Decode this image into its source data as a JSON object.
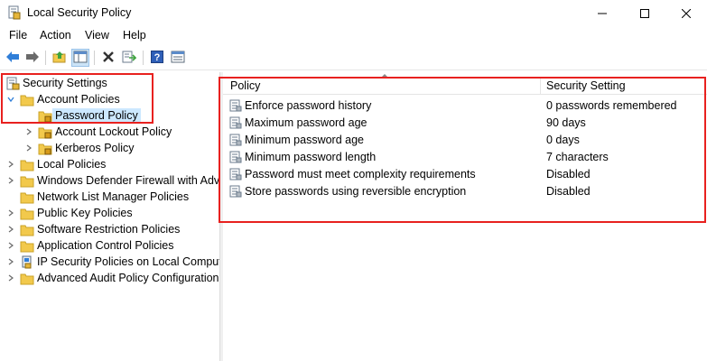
{
  "window": {
    "title": "Local Security Policy",
    "app_icon": "security-policy-icon",
    "controls": [
      "minimize-icon",
      "maximize-icon",
      "close-icon"
    ]
  },
  "menu": {
    "items": [
      "File",
      "Action",
      "View",
      "Help"
    ]
  },
  "toolbar": {
    "buttons": [
      "back-arrow-icon",
      "forward-arrow-icon",
      "up-folder-icon",
      "show-hide-tree-icon",
      "delete-icon",
      "export-list-icon",
      "help-icon",
      "properties-icon"
    ]
  },
  "tree": {
    "root": "Security Settings",
    "items": [
      {
        "label": "Security Settings",
        "icon": "security-settings-icon",
        "level": 0,
        "state": "none"
      },
      {
        "label": "Account Policies",
        "icon": "folder-icon",
        "level": 1,
        "state": "expanded"
      },
      {
        "label": "Password Policy",
        "icon": "policy-folder-icon",
        "level": 2,
        "state": "none",
        "selected": true
      },
      {
        "label": "Account Lockout Policy",
        "icon": "policy-folder-icon",
        "level": 2,
        "state": "collapsed"
      },
      {
        "label": "Kerberos Policy",
        "icon": "policy-folder-icon",
        "level": 2,
        "state": "collapsed"
      },
      {
        "label": "Local Policies",
        "icon": "folder-icon",
        "level": 1,
        "state": "collapsed"
      },
      {
        "label": "Windows Defender Firewall with Adva",
        "icon": "folder-icon",
        "level": 1,
        "state": "collapsed"
      },
      {
        "label": "Network List Manager Policies",
        "icon": "folder-icon",
        "level": 1,
        "state": "none"
      },
      {
        "label": "Public Key Policies",
        "icon": "folder-icon",
        "level": 1,
        "state": "collapsed"
      },
      {
        "label": "Software Restriction Policies",
        "icon": "folder-icon",
        "level": 1,
        "state": "collapsed"
      },
      {
        "label": "Application Control Policies",
        "icon": "folder-icon",
        "level": 1,
        "state": "collapsed"
      },
      {
        "label": "IP Security Policies on Local Compute",
        "icon": "ip-security-icon",
        "level": 1,
        "state": "collapsed"
      },
      {
        "label": "Advanced Audit Policy Configuration",
        "icon": "folder-icon",
        "level": 1,
        "state": "collapsed"
      }
    ]
  },
  "list": {
    "columns": [
      "Policy",
      "Security Setting"
    ],
    "rows": [
      {
        "policy": "Enforce password history",
        "setting": "0 passwords remembered"
      },
      {
        "policy": "Maximum password age",
        "setting": "90 days"
      },
      {
        "policy": "Minimum password age",
        "setting": "0 days"
      },
      {
        "policy": "Minimum password length",
        "setting": "7 characters"
      },
      {
        "policy": "Password must meet complexity requirements",
        "setting": "Disabled"
      },
      {
        "policy": "Store passwords using reversible encryption",
        "setting": "Disabled"
      }
    ]
  },
  "colors": {
    "annotation": "#e8211f",
    "selection": "#cce8ff",
    "folder": "#f2c94c"
  }
}
